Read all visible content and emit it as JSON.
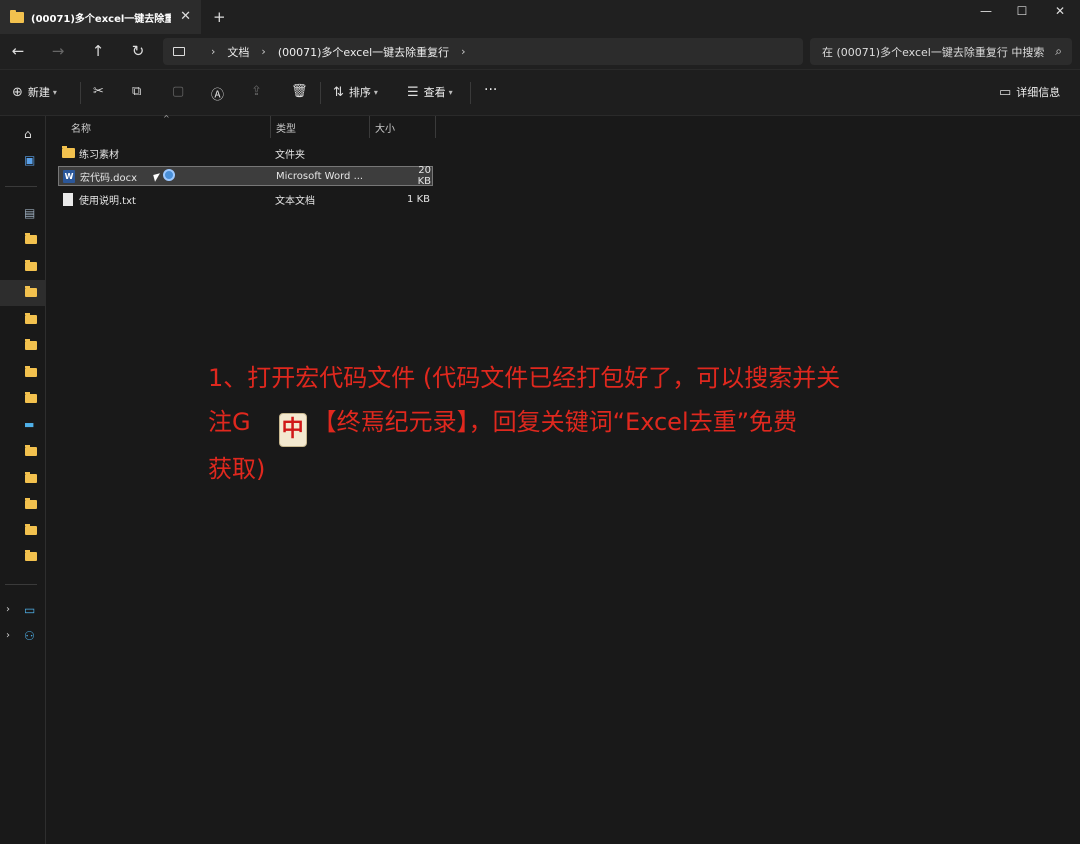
{
  "window": {
    "tab_title": "(00071)多个excel一键去除重复",
    "tab_close": "✕",
    "new_tab": "+",
    "minimize": "—",
    "maximize": "☐",
    "close": "✕"
  },
  "navigation": {
    "back": "←",
    "forward": "→",
    "up": "↑",
    "refresh": "↻",
    "breadcrumbs": [
      "文档",
      "(00071)多个excel一键去除重复行"
    ],
    "search_placeholder": "在 (00071)多个excel一键去除重复行 中搜索"
  },
  "toolbar": {
    "new_label": "新建",
    "sort_label": "排序",
    "view_label": "查看",
    "more_label": "···",
    "details_label": "详细信息"
  },
  "columns": {
    "name": "名称",
    "type": "类型",
    "size": "大小"
  },
  "files": [
    {
      "name": "练习素材",
      "type": "文件夹",
      "size": "",
      "icon": "folder-icon"
    },
    {
      "name": "宏代码.docx",
      "type": "Microsoft Word ...",
      "size": "20 KB",
      "icon": "word-doc-icon"
    },
    {
      "name": "使用说明.txt",
      "type": "文本文档",
      "size": "1 KB",
      "icon": "text-file-icon"
    }
  ],
  "annotation": {
    "line1": "1、打开宏代码文件 (代码文件已经打包好了，可以搜索并关",
    "line2_prefix": "注G",
    "mahjong_glyph": "中",
    "line2_suffix": "【终焉纪元录】，回复关键词“Excel去重”免费",
    "line3": "获取)",
    "color": "#e0281e"
  },
  "colors": {
    "background": "#191919",
    "folder": "#f2c14e",
    "selection": "#3d3d3d"
  }
}
